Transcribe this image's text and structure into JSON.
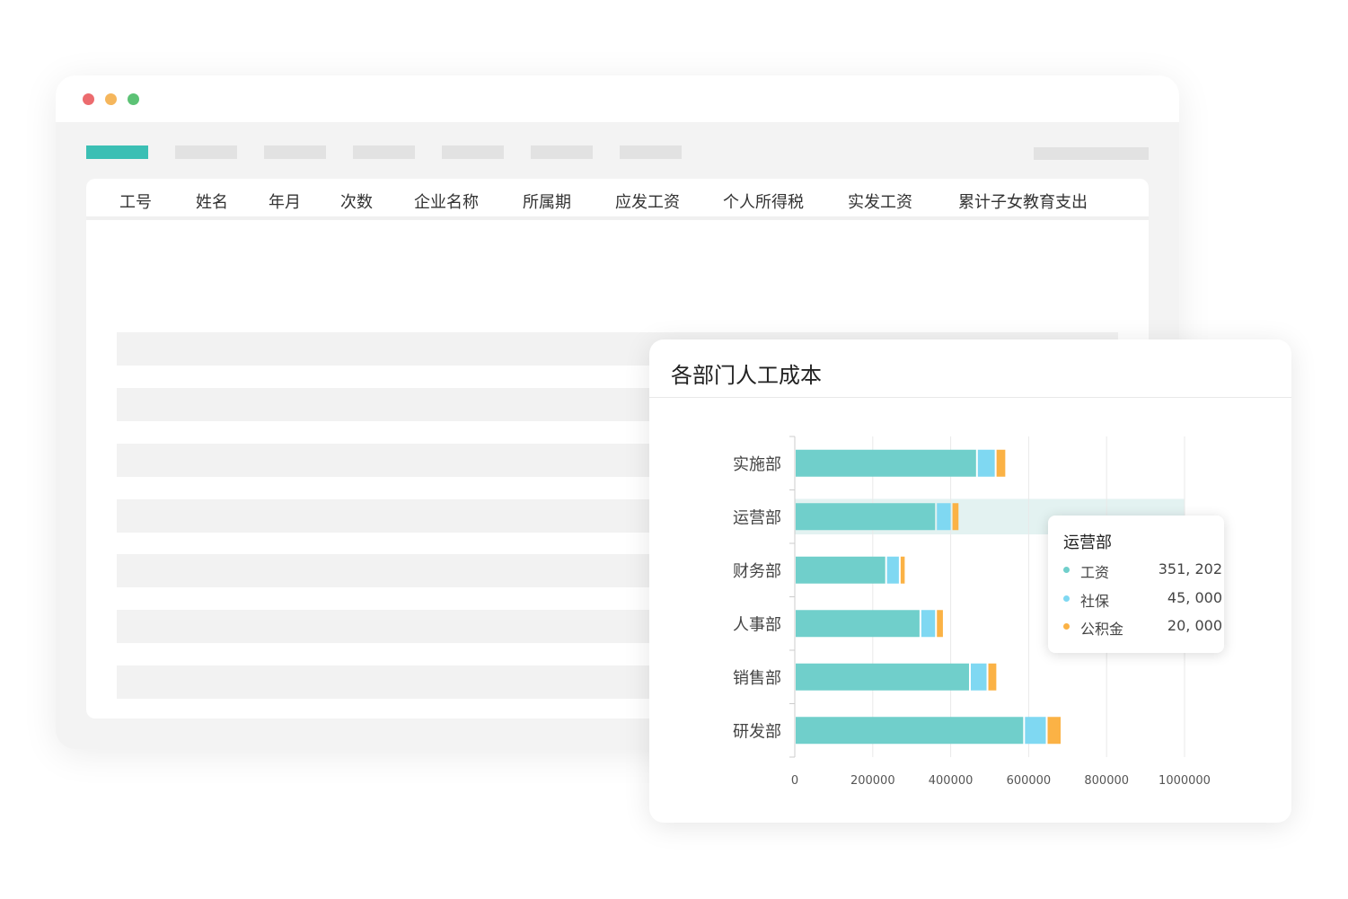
{
  "colors": {
    "window_dot_red": "#ec6b6e",
    "window_dot_yellow": "#f5b65c",
    "window_dot_green": "#5cc275",
    "active_tab": "#3bbfb4",
    "salary": "#70cfcb",
    "social_security": "#7fd8f2",
    "housing_fund": "#fbb245",
    "highlight_band": "#e3f2f1"
  },
  "table": {
    "headers": [
      "工号",
      "姓名",
      "年月",
      "次数",
      "企业名称",
      "所属期",
      "应发工资",
      "个人所得税",
      "实发工资",
      "累计子女教育支出"
    ]
  },
  "chart_card": {
    "title": "各部门人工成本"
  },
  "chart_data": {
    "type": "bar",
    "orientation": "horizontal",
    "stacked": true,
    "categories": [
      "实施部",
      "运营部",
      "财务部",
      "人事部",
      "销售部",
      "研发部"
    ],
    "series": [
      {
        "name": "工资",
        "values": [
          465000,
          360000,
          232000,
          320000,
          447000,
          586000
        ]
      },
      {
        "name": "社保",
        "values": [
          48000,
          40000,
          35000,
          40000,
          45000,
          58000
        ]
      },
      {
        "name": "公积金",
        "values": [
          27000,
          20000,
          15000,
          20000,
          25000,
          38000
        ]
      }
    ],
    "x_ticks": [
      "0",
      "200000",
      "400000",
      "600000",
      "800000",
      "1000000"
    ],
    "xlim": [
      0,
      1000000
    ],
    "grid": true,
    "highlighted_category": "运营部"
  },
  "tooltip": {
    "title": "运营部",
    "rows": [
      {
        "name": "工资",
        "value": "351, 202"
      },
      {
        "name": "社保",
        "value": "45, 000"
      },
      {
        "name": "公积金",
        "value": "20, 000"
      }
    ]
  }
}
